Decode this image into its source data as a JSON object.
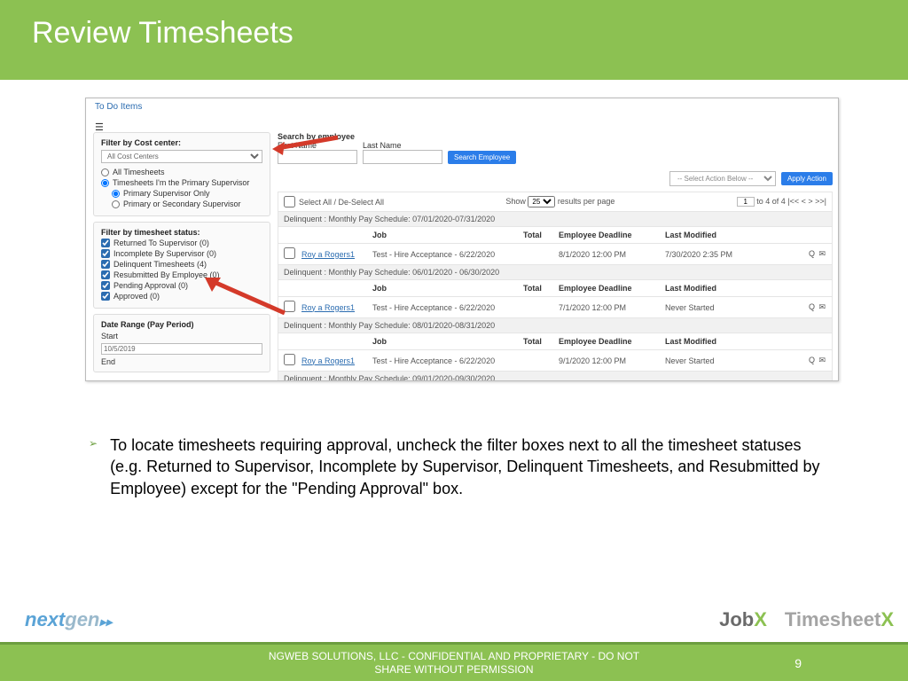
{
  "slide": {
    "title": "Review Timesheets",
    "bullet": "To locate timesheets requiring approval, uncheck the filter boxes next to all the timesheet statuses (e.g. Returned to Supervisor, Incomplete by Supervisor, Delinquent Timesheets, and Resubmitted by Employee) except for the \"Pending Approval\" box.",
    "footer": "NGWEB SOLUTIONS, LLC - CONFIDENTIAL AND  PROPRIETARY - DO NOT SHARE WITHOUT PERMISSION",
    "page": "9"
  },
  "shot": {
    "todo": "To Do Items",
    "search_label": "Search by employee",
    "first_name": "First Name",
    "last_name": "Last Name",
    "search_btn": "Search Employee",
    "action_sel": "-- Select Action Below --",
    "apply": "Apply Action",
    "select_all": "Select All / De-Select All",
    "show": "Show",
    "per_page": "25",
    "results": "results per page",
    "page_input": "1",
    "page_text": "to 4 of 4 |<<  <   >  >>|",
    "cc": {
      "title": "Filter by Cost center:",
      "sel": "All Cost Centers",
      "r1": "All Timesheets",
      "r2": "Timesheets I'm the Primary Supervisor",
      "r2a": "Primary Supervisor Only",
      "r2b": "Primary or Secondary Supervisor"
    },
    "fs": {
      "title": "Filter by timesheet status:",
      "s1": "Returned To Supervisor (0)",
      "s2": "Incomplete By Supervisor (0)",
      "s3": "Delinquent Timesheets (4)",
      "s4": "Resubmitted By Employee (0)",
      "s5": "Pending Approval (0)",
      "s6": "Approved (0)"
    },
    "dr": {
      "title": "Date Range (Pay Period)",
      "start": "Start",
      "start_v": "10/5/2019",
      "end": "End"
    },
    "hdr": {
      "job": "Job",
      "total": "Total",
      "deadline": "Employee Deadline",
      "mod": "Last Modified"
    },
    "groups": [
      "Delinquent : Monthly Pay Schedule: 07/01/2020-07/31/2020",
      "Delinquent : Monthly Pay Schedule: 06/01/2020 - 06/30/2020",
      "Delinquent : Monthly Pay Schedule: 08/01/2020-08/31/2020",
      "Delinquent : Monthly Pay Schedule: 09/01/2020-09/30/2020"
    ],
    "rows": [
      {
        "name": "Roy a Rogers1",
        "job": "Test - Hire Acceptance - 6/22/2020",
        "deadline": "8/1/2020 12:00 PM",
        "mod": "7/30/2020 2:35 PM"
      },
      {
        "name": "Roy a Rogers1",
        "job": "Test - Hire Acceptance - 6/22/2020",
        "deadline": "7/1/2020 12:00 PM",
        "mod": "Never Started"
      },
      {
        "name": "Roy a Rogers1",
        "job": "Test - Hire Acceptance - 6/22/2020",
        "deadline": "9/1/2020 12:00 PM",
        "mod": "Never Started"
      }
    ]
  }
}
